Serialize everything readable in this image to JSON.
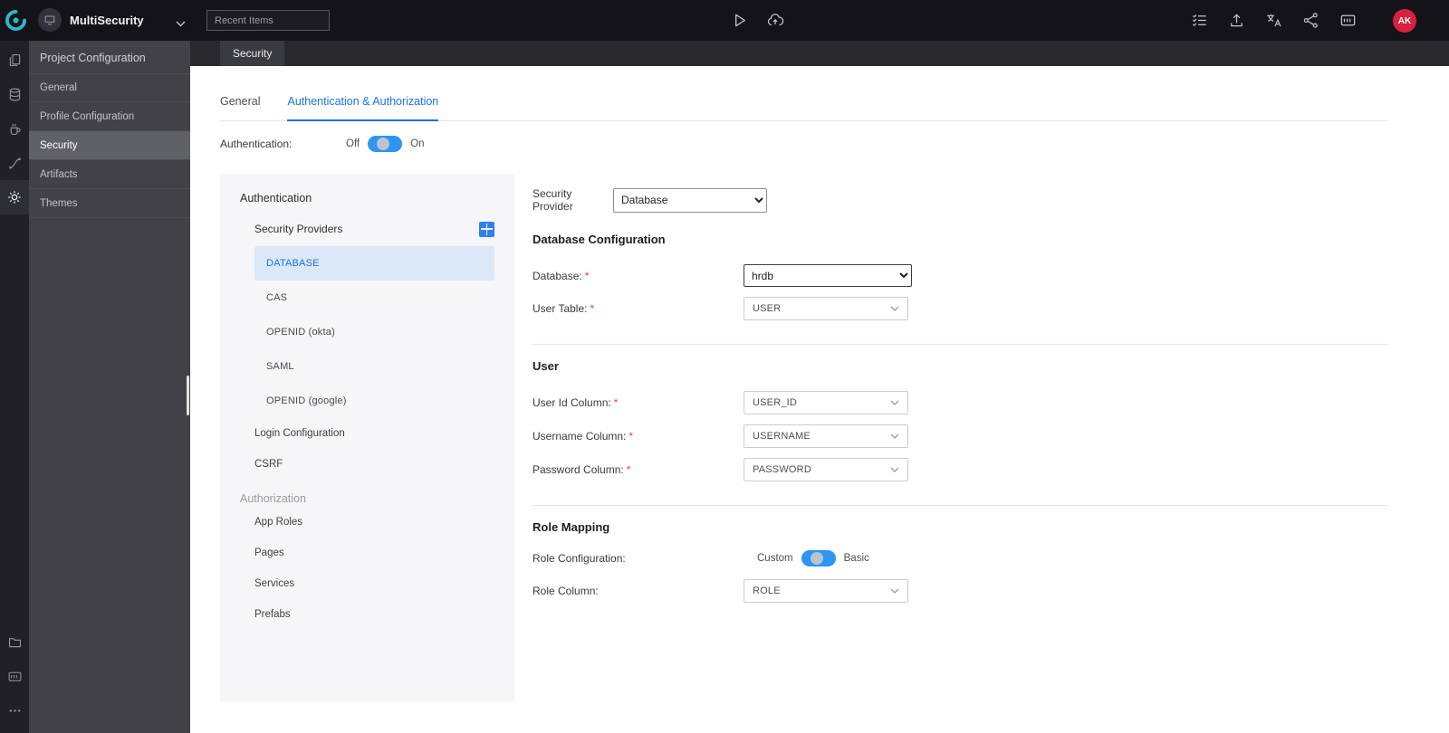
{
  "topbar": {
    "app_name": "MultiSecurity",
    "recent_items": "Recent Items",
    "avatar": "AK",
    "icons": [
      "wavemaker-logo",
      "app-icon",
      "chevron-down-icon",
      "run-icon",
      "deploy-cloud-icon",
      "checklist-icon",
      "export-icon",
      "translate-icon",
      "branch-icon",
      "console-icon"
    ]
  },
  "rail": {
    "icons": [
      "pages-icon",
      "database-icon",
      "java-services-icon",
      "apis-icon",
      "settings-gear-icon",
      "folder-icon",
      "logs-icon",
      "more-icon"
    ],
    "active": "settings-gear-icon"
  },
  "sidebar": {
    "title": "Project Configuration",
    "items": [
      {
        "label": "General"
      },
      {
        "label": "Profile Configuration"
      },
      {
        "label": "Security"
      },
      {
        "label": "Artifacts"
      },
      {
        "label": "Themes"
      }
    ],
    "active_item": "Security"
  },
  "workspace": {
    "tab": "Security"
  },
  "tabs": {
    "general": "General",
    "auth": "Authentication & Authorization",
    "active": "Authentication & Authorization"
  },
  "auth_toggle": {
    "label": "Authentication:",
    "off": "Off",
    "on": "On",
    "state": "on"
  },
  "tree": {
    "authentication": "Authentication",
    "security_providers": "Security Providers",
    "providers": [
      "DATABASE",
      "CAS",
      "OPENID (okta)",
      "SAML",
      "OPENID (google)"
    ],
    "selected_provider": "DATABASE",
    "login_configuration": "Login Configuration",
    "csrf": "CSRF",
    "authorization": "Authorization",
    "items": [
      "App Roles",
      "Pages",
      "Services",
      "Prefabs"
    ]
  },
  "form": {
    "required": "*",
    "security_provider_label": "Security Provider",
    "security_provider_value": "Database",
    "database_configuration_heading": "Database Configuration",
    "database_label": "Database:",
    "database_value": "hrdb",
    "user_table_label": "User Table:",
    "user_table_value": "USER",
    "user_heading": "User",
    "user_id_label": "User Id Column:",
    "user_id_value": "USER_ID",
    "username_label": "Username Column:",
    "username_value": "USERNAME",
    "password_label": "Password Column:",
    "password_value": "PASSWORD",
    "role_heading": "Role Mapping",
    "role_config_label": "Role Configuration:",
    "role_custom": "Custom",
    "role_basic": "Basic",
    "role_selected": "Basic",
    "role_column_label": "Role Column:",
    "role_column_value": "ROLE"
  },
  "colors": {
    "accent_blue": "#1a73e8",
    "toggle_blue": "#2e95f2",
    "selected_provider_bg": "#dbe8f8",
    "avatar_red": "#d6213f",
    "topbar_bg": "#141418",
    "sidebar_bg": "#414147"
  }
}
